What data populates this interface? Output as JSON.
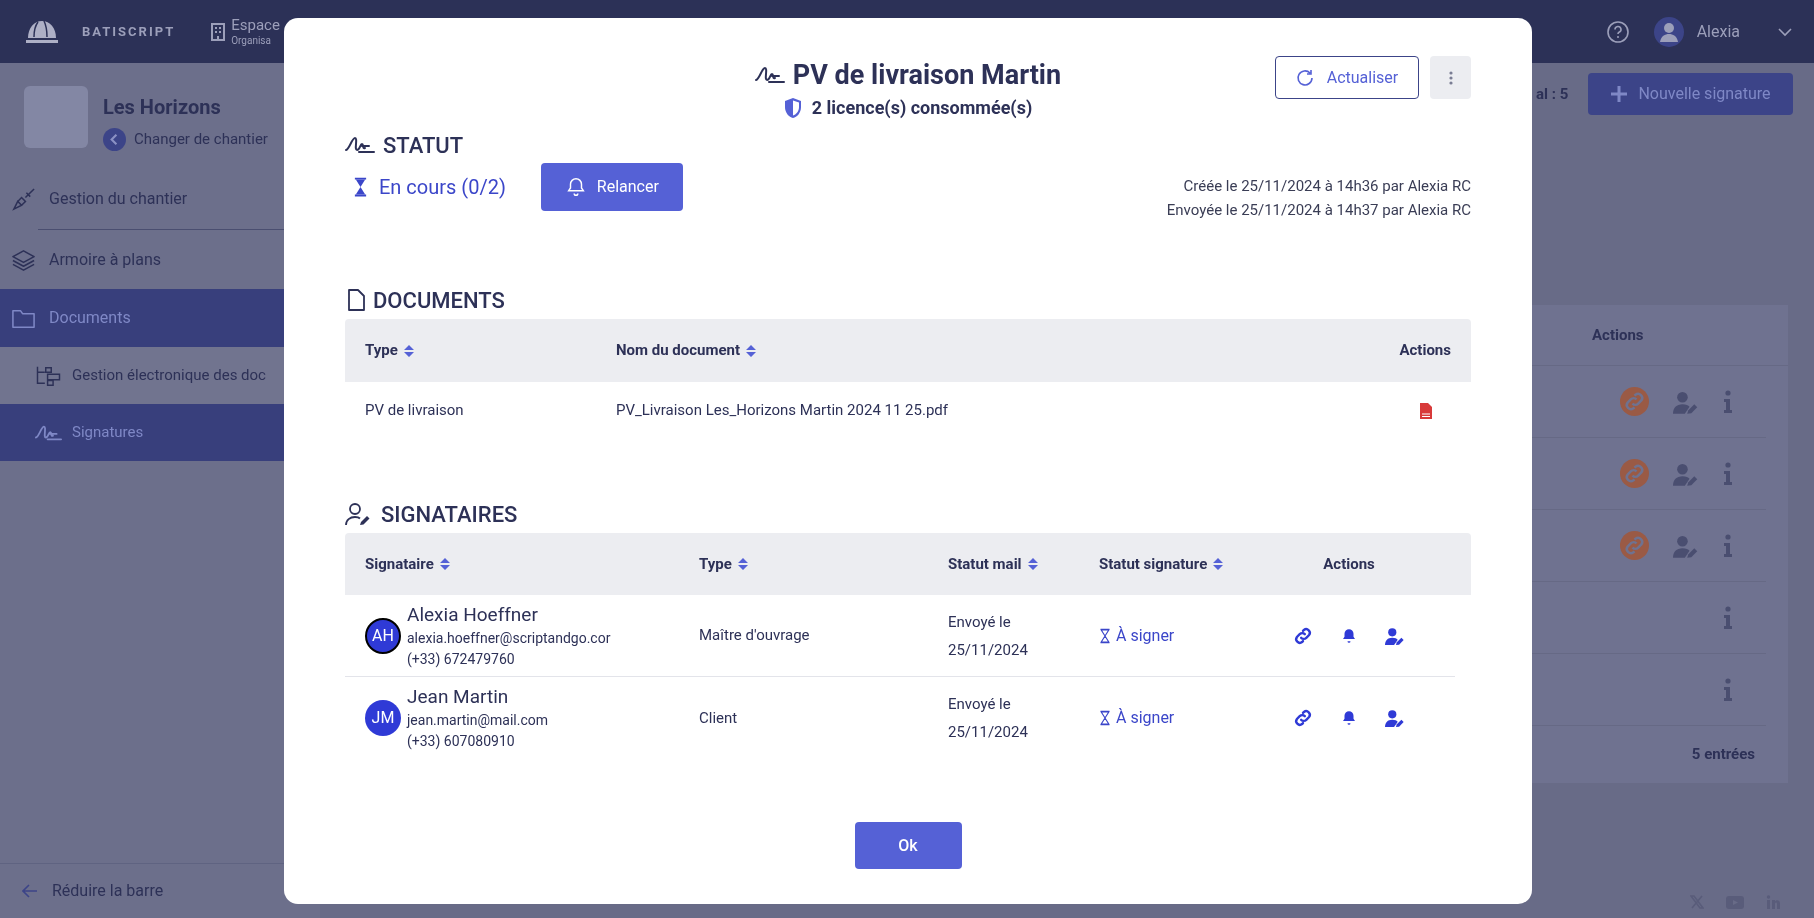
{
  "header": {
    "logo_text": "BATISCRIPT",
    "space": {
      "title": "Espace",
      "subtitle": "Organisa"
    },
    "user": "Alexia"
  },
  "sidebar": {
    "project": {
      "name": "Les Horizons",
      "back_link": "Changer de chantier"
    },
    "items": [
      {
        "label": "Gestion du chantier",
        "selected": false
      },
      {
        "label": "Armoire à plans",
        "selected": false
      },
      {
        "label": "Documents",
        "selected": true,
        "children": [
          {
            "label": "Gestion électronique des doc",
            "selected": false
          },
          {
            "label": "Signatures",
            "selected": true
          }
        ]
      }
    ],
    "collapse": "Réduire la barre"
  },
  "background": {
    "total": "al : 5",
    "new_button": "Nouvelle signature",
    "actions_header": "Actions",
    "rows": [
      {
        "kind": "full"
      },
      {
        "kind": "full"
      },
      {
        "kind": "full"
      },
      {
        "kind": "info"
      },
      {
        "kind": "info"
      }
    ],
    "count": "5 entrées"
  },
  "modal": {
    "title": "PV de livraison Martin",
    "licences": "2 licence(s) consommée(s)",
    "refresh": "Actualiser",
    "status": {
      "heading": "STATUT",
      "state": "En cours (0/2)",
      "remind": "Relancer",
      "created": "Créée le 25/11/2024 à 14h36 par Alexia RC",
      "sent": "Envoyée le 25/11/2024 à 14h37 par Alexia RC"
    },
    "documents": {
      "heading": "DOCUMENTS",
      "columns": [
        {
          "label": "Type",
          "sortable": true
        },
        {
          "label": "Nom du document",
          "sortable": true
        },
        {
          "label": "Actions",
          "sortable": false
        }
      ],
      "rows": [
        {
          "type": "PV de livraison",
          "name": "PV_Livraison Les_Horizons Martin 2024 11 25.pdf"
        }
      ]
    },
    "signers": {
      "heading": "SIGNATAIRES",
      "columns": [
        {
          "label": "Signataire",
          "sortable": true
        },
        {
          "label": "Type",
          "sortable": true
        },
        {
          "label": "Statut mail",
          "sortable": true
        },
        {
          "label": "Statut signature",
          "sortable": true
        },
        {
          "label": "Actions",
          "sortable": false
        }
      ],
      "rows": [
        {
          "initials": "AH",
          "highlighted": true,
          "name": "Alexia Hoeffner",
          "email": "alexia.hoeffner@scriptandgo.cor",
          "phone": "(+33) 672479760",
          "type": "Maître d'ouvrage",
          "mail_status": "Envoyé le 25/11/2024",
          "signature_status": "À signer"
        },
        {
          "initials": "JM",
          "highlighted": false,
          "name": "Jean Martin",
          "email": "jean.martin@mail.com",
          "phone": "(+33) 607080910",
          "type": "Client",
          "mail_status": "Envoyé le 25/11/2024",
          "signature_status": "À signer"
        }
      ]
    },
    "ok": "Ok"
  }
}
